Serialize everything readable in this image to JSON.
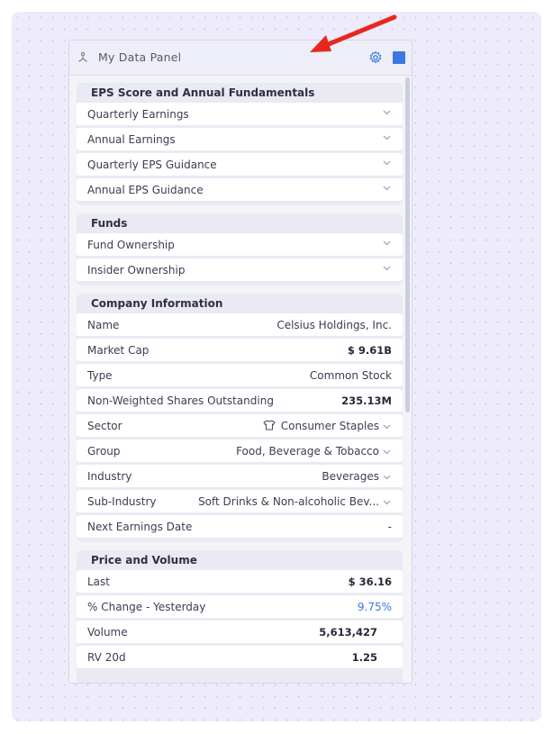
{
  "panel": {
    "title": "My Data Panel"
  },
  "sections": {
    "eps": {
      "title": "EPS Score and Annual Fundamentals",
      "items": [
        "Quarterly Earnings",
        "Annual Earnings",
        "Quarterly EPS Guidance",
        "Annual EPS Guidance"
      ]
    },
    "funds": {
      "title": "Funds",
      "items": [
        "Fund Ownership",
        "Insider Ownership"
      ]
    },
    "company": {
      "title": "Company Information",
      "rows": [
        {
          "label": "Name",
          "value": "Celsius Holdings, Inc."
        },
        {
          "label": "Market Cap",
          "value": "$ 9.61B"
        },
        {
          "label": "Type",
          "value": "Common Stock"
        },
        {
          "label": "Non-Weighted Shares Outstanding",
          "value": "235.13M"
        },
        {
          "label": "Sector",
          "value": "Consumer Staples"
        },
        {
          "label": "Group",
          "value": "Food, Beverage & Tobacco"
        },
        {
          "label": "Industry",
          "value": "Beverages"
        },
        {
          "label": "Sub-Industry",
          "value": "Soft Drinks & Non-alcoholic Bev..."
        },
        {
          "label": "Next Earnings Date",
          "value": "-"
        }
      ]
    },
    "price": {
      "title": "Price and Volume",
      "rows": [
        {
          "label": "Last",
          "value": "$ 36.16"
        },
        {
          "label": "% Change - Yesterday",
          "value": "9.75%"
        },
        {
          "label": "Volume",
          "value": "5,613,427"
        },
        {
          "label": "RV 20d",
          "value": "1.25"
        }
      ]
    }
  },
  "colors": {
    "accent": "#3d78e0",
    "arrow": "#e8281e",
    "canvas": "#eeebfb"
  }
}
